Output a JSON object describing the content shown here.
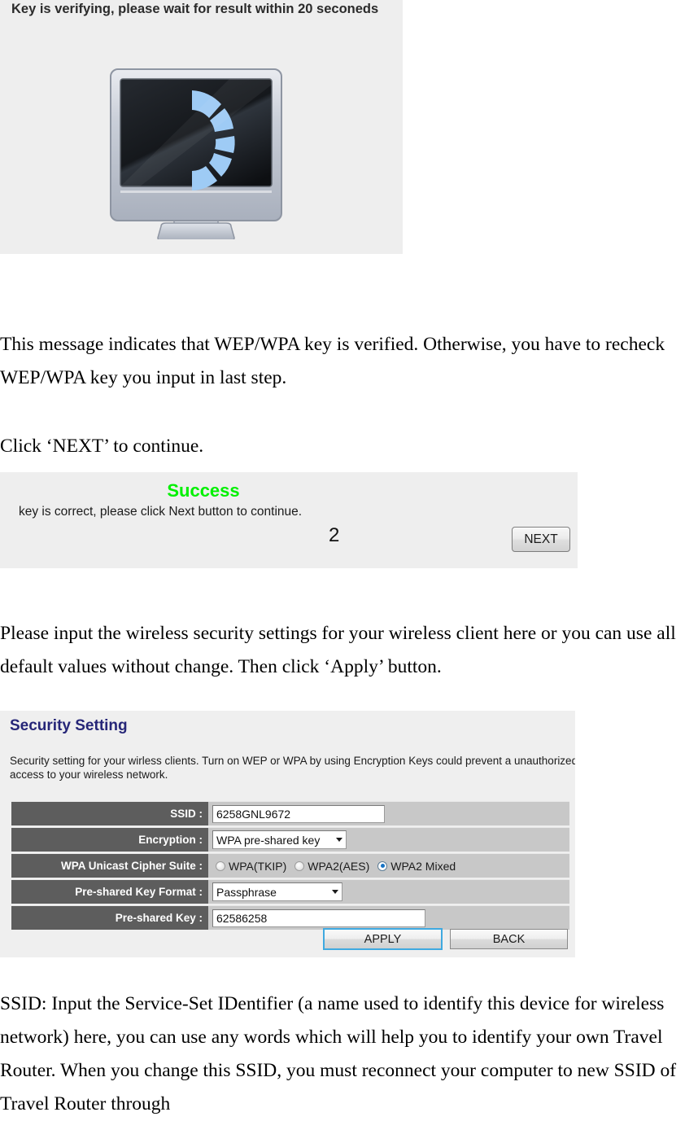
{
  "verify_panel": {
    "title": "Key is verifying, please wait for result within 20 seconeds",
    "icon": "monitor-spinner-icon"
  },
  "paragraphs": {
    "p1": "This message indicates that WEP/WPA key is verified. Otherwise, you have to recheck WEP/WPA key you input in last step.",
    "p2": "Click ‘NEXT’ to continue.",
    "p3": "Please input the wireless security settings for your wireless client here or you can use all default values without change. Then click ‘Apply’ button.",
    "p4": "SSID: Input the Service-Set IDentifier (a name used to identify this device for wireless network) here, you can use any words which will help you to identify your own Travel Router. When you change this SSID, you must reconnect your computer to new SSID of Travel Router through"
  },
  "success_panel": {
    "heading": "Success",
    "subtext": "key is correct, please click Next button to continue.",
    "step_number": "2",
    "next_label": "NEXT",
    "heading_color": "#00f000"
  },
  "security_panel": {
    "title": "Security Setting",
    "title_color": "#262678",
    "description": "Security setting for your wirless clients. Turn on WEP or WPA by using Encryption Keys could prevent a unauthorized access to your wireless network.",
    "rows": [
      {
        "label": "SSID :",
        "type": "text",
        "value": "6258GNL9672"
      },
      {
        "label": "Encryption :",
        "type": "select",
        "value": "WPA pre-shared key"
      },
      {
        "label": "WPA Unicast Cipher Suite :",
        "type": "radio"
      },
      {
        "label": "Pre-shared Key Format :",
        "type": "select",
        "value": "Passphrase"
      },
      {
        "label": "Pre-shared Key :",
        "type": "text",
        "value": "62586258"
      }
    ],
    "cipher_options": [
      {
        "label": "WPA(TKIP)",
        "selected": false
      },
      {
        "label": "WPA2(AES)",
        "selected": false
      },
      {
        "label": "WPA2 Mixed",
        "selected": true
      }
    ],
    "apply_label": "APPLY",
    "back_label": "BACK",
    "label_bg": "#5d5d5d",
    "row_bg": "#c8c8c8",
    "panel_bg": "#efefef",
    "focus_color": "#3fa9e0"
  }
}
